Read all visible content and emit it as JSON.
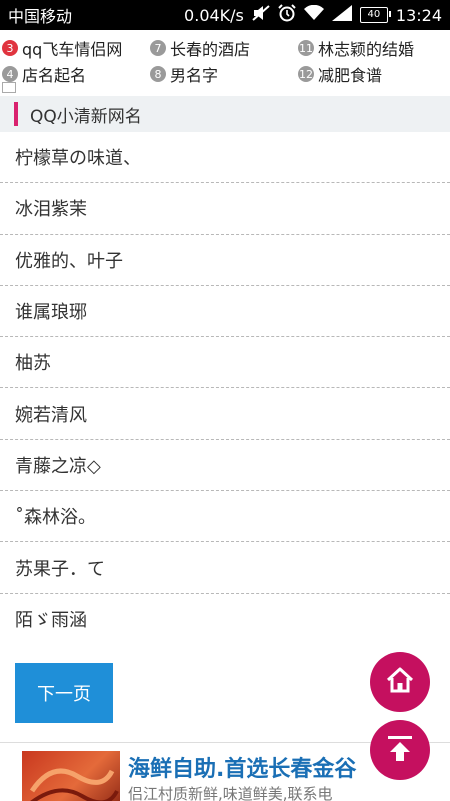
{
  "status_bar": {
    "carrier": "中国移动",
    "speed": "0.04K/s",
    "battery": "40",
    "time": "13:24"
  },
  "hot_links": [
    {
      "num": "3",
      "label": "qq飞车情侣网"
    },
    {
      "num": "7",
      "label": "长春的酒店"
    },
    {
      "num": "11",
      "label": "林志颖的结婚"
    },
    {
      "num": "4",
      "label": "店名起名"
    },
    {
      "num": "8",
      "label": "男名字"
    },
    {
      "num": "12",
      "label": "减肥食谱"
    }
  ],
  "section": {
    "title": "QQ小清新网名"
  },
  "names": [
    "柠檬草の味道、",
    "冰泪紫茉",
    "优雅的、叶子",
    "谁属琅琊",
    "柚苏",
    "婉若清风",
    "青藤之凉◇",
    "˚森林浴。",
    "苏果子．て",
    "陌ゞ雨涵"
  ],
  "next_button": "下一页",
  "ad": {
    "title": "海鲜自助.首选长春金谷",
    "desc": "侣江村质新鲜,味道鲜美,联系电"
  },
  "colors": {
    "accent": "#d9226e",
    "button_blue": "#1f8fd8",
    "fab": "#c5105f"
  },
  "icons": {
    "home": "home-icon",
    "top": "back-to-top-icon"
  }
}
